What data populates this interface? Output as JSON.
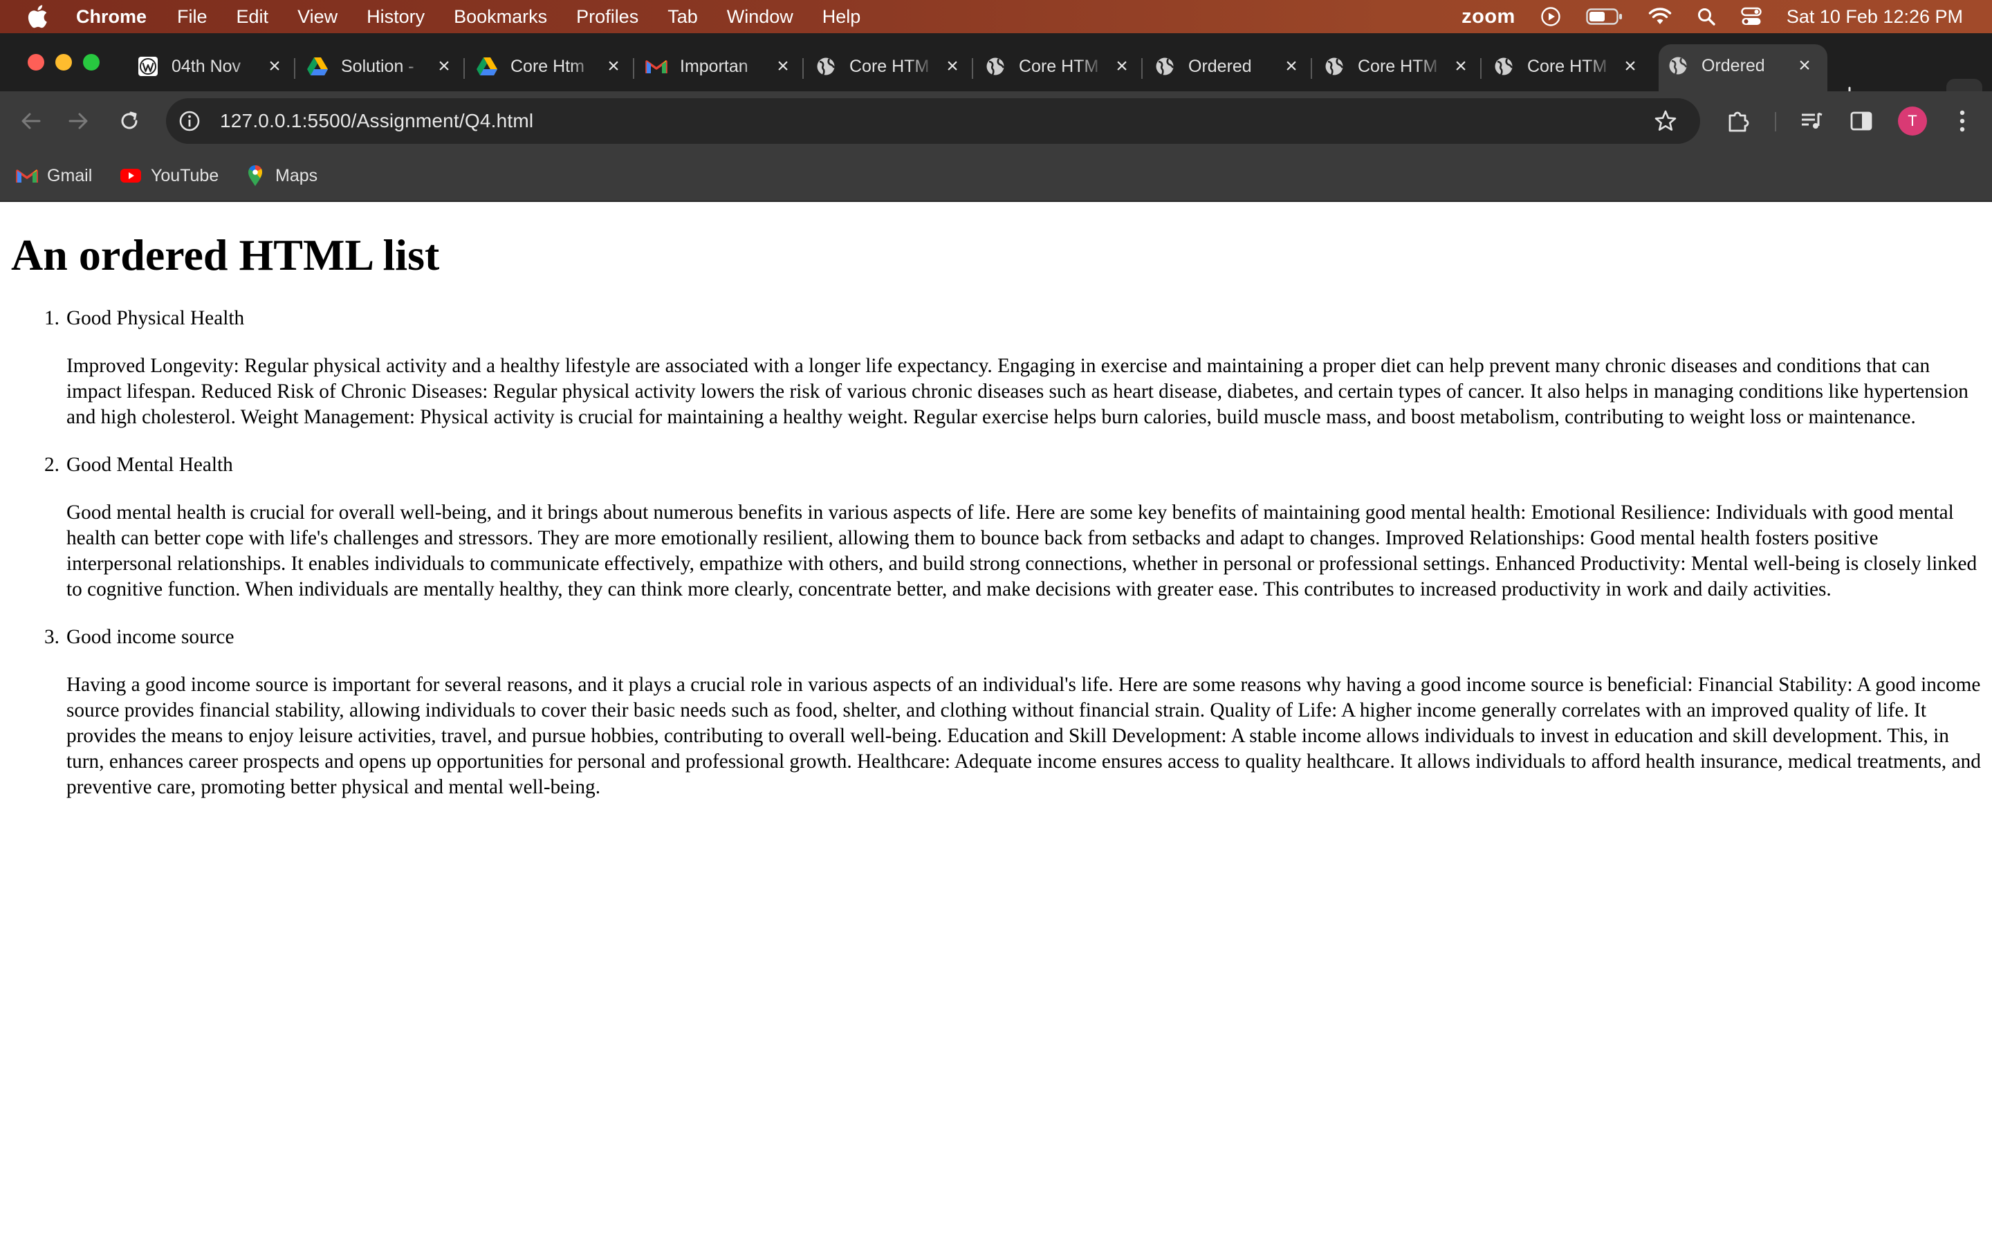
{
  "menubar": {
    "app_name": "Chrome",
    "items": [
      "File",
      "Edit",
      "View",
      "History",
      "Bookmarks",
      "Profiles",
      "Tab",
      "Window",
      "Help"
    ],
    "zoom_label": "zoom",
    "clock": "Sat 10 Feb  12:26 PM"
  },
  "tabs": [
    {
      "title": "04th Nov",
      "icon": "wordpress-icon"
    },
    {
      "title": "Solution -",
      "icon": "google-drive-icon"
    },
    {
      "title": "Core Htm",
      "icon": "google-drive-icon"
    },
    {
      "title": "Importan",
      "icon": "gmail-icon"
    },
    {
      "title": "Core HTM",
      "icon": "globe-icon"
    },
    {
      "title": "Core HTM",
      "icon": "globe-icon"
    },
    {
      "title": "Ordered",
      "icon": "globe-icon"
    },
    {
      "title": "Core HTM",
      "icon": "globe-icon"
    },
    {
      "title": "Core HTM",
      "icon": "globe-icon"
    },
    {
      "title": "Ordered",
      "icon": "globe-icon",
      "active": true
    }
  ],
  "toolbar": {
    "url": "127.0.0.1:5500/Assignment/Q4.html",
    "avatar_initial": "T"
  },
  "bookmarks": [
    {
      "label": "Gmail",
      "icon": "gmail-icon"
    },
    {
      "label": "YouTube",
      "icon": "youtube-icon"
    },
    {
      "label": "Maps",
      "icon": "maps-icon"
    }
  ],
  "page": {
    "heading": "An ordered HTML list",
    "items": [
      {
        "number": "1.",
        "title": "Good Physical Health",
        "text": "Improved Longevity: Regular physical activity and a healthy lifestyle are associated with a longer life expectancy. Engaging in exercise and maintaining a proper diet can help prevent many chronic diseases and conditions that can impact lifespan. Reduced Risk of Chronic Diseases: Regular physical activity lowers the risk of various chronic diseases such as heart disease, diabetes, and certain types of cancer. It also helps in managing conditions like hypertension and high cholesterol. Weight Management: Physical activity is crucial for maintaining a healthy weight. Regular exercise helps burn calories, build muscle mass, and boost metabolism, contributing to weight loss or maintenance."
      },
      {
        "number": "2.",
        "title": "Good Mental Health",
        "text": "Good mental health is crucial for overall well-being, and it brings about numerous benefits in various aspects of life. Here are some key benefits of maintaining good mental health: Emotional Resilience: Individuals with good mental health can better cope with life's challenges and stressors. They are more emotionally resilient, allowing them to bounce back from setbacks and adapt to changes. Improved Relationships: Good mental health fosters positive interpersonal relationships. It enables individuals to communicate effectively, empathize with others, and build strong connections, whether in personal or professional settings. Enhanced Productivity: Mental well-being is closely linked to cognitive function. When individuals are mentally healthy, they can think more clearly, concentrate better, and make decisions with greater ease. This contributes to increased productivity in work and daily activities."
      },
      {
        "number": "3.",
        "title": "Good income source",
        "text": "Having a good income source is important for several reasons, and it plays a crucial role in various aspects of an individual's life. Here are some reasons why having a good income source is beneficial: Financial Stability: A good income source provides financial stability, allowing individuals to cover their basic needs such as food, shelter, and clothing without financial strain. Quality of Life: A higher income generally correlates with an improved quality of life. It provides the means to enjoy leisure activities, travel, and pursue hobbies, contributing to overall well-being. Education and Skill Development: A stable income allows individuals to invest in education and skill development. This, in turn, enhances career prospects and opens up opportunities for personal and professional growth. Healthcare: Adequate income ensures access to quality healthcare. It allows individuals to afford health insurance, medical treatments, and preventive care, promoting better physical and mental well-being."
      }
    ]
  }
}
